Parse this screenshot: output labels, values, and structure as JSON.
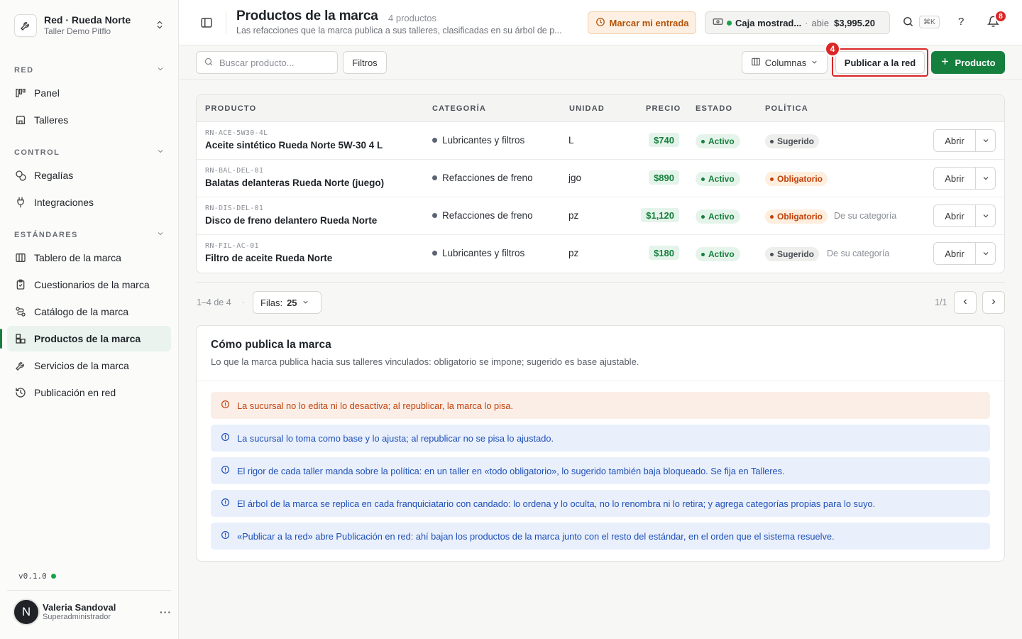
{
  "sidebar": {
    "org": {
      "name": "Red · Rueda Norte",
      "sub": "Taller Demo Pitflo"
    },
    "sections": [
      {
        "label": "RED"
      },
      {
        "label": "CONTROL"
      },
      {
        "label": "ESTÁNDARES"
      }
    ],
    "items": [
      {
        "label": "Panel",
        "icon": "kanban-icon"
      },
      {
        "label": "Talleres",
        "icon": "store-icon"
      },
      {
        "label": "Regalías",
        "icon": "coins-icon"
      },
      {
        "label": "Integraciones",
        "icon": "plug-icon"
      },
      {
        "label": "Tablero de la marca",
        "icon": "columns-icon"
      },
      {
        "label": "Cuestionarios de la marca",
        "icon": "clipboard-icon"
      },
      {
        "label": "Catálogo de la marca",
        "icon": "route-icon"
      },
      {
        "label": "Productos de la marca",
        "icon": "boxes-icon",
        "active": true
      },
      {
        "label": "Servicios de la marca",
        "icon": "wrench-icon"
      },
      {
        "label": "Publicación en red",
        "icon": "history-icon"
      }
    ],
    "version": "v0.1.0",
    "user": {
      "initial": "N",
      "name": "Valeria Sandoval",
      "role": "Superadministrador"
    }
  },
  "header": {
    "title": "Productos de la marca",
    "count": "4 productos",
    "description": "Las refacciones que la marca publica a sus talleres, clasificadas en su árbol de p...",
    "entrada_label": "Marcar mi entrada",
    "caja": {
      "name": "Caja mostrad...",
      "status": "abie",
      "amount": "$3,995.20"
    },
    "kbd": "⌘K",
    "help": "?",
    "notifications": "8"
  },
  "toolbar": {
    "search_placeholder": "Buscar producto...",
    "filters_label": "Filtros",
    "columns_label": "Columnas",
    "publish_label": "Publicar a la red",
    "step_badge": "4",
    "add_label": "Producto"
  },
  "table": {
    "headers": [
      "PRODUCTO",
      "CATEGORÍA",
      "UNIDAD",
      "PRECIO",
      "ESTADO",
      "POLÍTICA"
    ],
    "open_label": "Abrir",
    "rows": [
      {
        "sku": "RN-ACE-5W30-4L",
        "name": "Aceite sintético Rueda Norte 5W-30 4 L",
        "category": "Lubricantes y filtros",
        "unit": "L",
        "price": "$740",
        "status": "Activo",
        "policy": "Sugerido",
        "policy_kind": "sug",
        "note": ""
      },
      {
        "sku": "RN-BAL-DEL-01",
        "name": "Balatas delanteras Rueda Norte (juego)",
        "category": "Refacciones de freno",
        "unit": "jgo",
        "price": "$890",
        "status": "Activo",
        "policy": "Obligatorio",
        "policy_kind": "obl",
        "note": ""
      },
      {
        "sku": "RN-DIS-DEL-01",
        "name": "Disco de freno delantero Rueda Norte",
        "category": "Refacciones de freno",
        "unit": "pz",
        "price": "$1,120",
        "status": "Activo",
        "policy": "Obligatorio",
        "policy_kind": "obl",
        "note": "De su categoría"
      },
      {
        "sku": "RN-FIL-AC-01",
        "name": "Filtro de aceite Rueda Norte",
        "category": "Lubricantes y filtros",
        "unit": "pz",
        "price": "$180",
        "status": "Activo",
        "policy": "Sugerido",
        "policy_kind": "sug",
        "note": "De su categoría"
      }
    ]
  },
  "pager": {
    "range": "1–4 de 4",
    "separator": "·",
    "rows_label": "Filas:",
    "rows_value": "25",
    "page": "1/1"
  },
  "info": {
    "title": "Cómo publica la marca",
    "subtitle": "Lo que la marca publica hacia sus talleres vinculados: obligatorio se impone; sugerido es base ajustable.",
    "notices": [
      {
        "kind": "warn",
        "text": "La sucursal no lo edita ni lo desactiva; al republicar, la marca lo pisa."
      },
      {
        "kind": "info",
        "text": "La sucursal lo toma como base y lo ajusta; al republicar no se pisa lo ajustado."
      },
      {
        "kind": "info",
        "text": "El rigor de cada taller manda sobre la política: en un taller en «todo obligatorio», lo sugerido también baja bloqueado. Se fija en Talleres."
      },
      {
        "kind": "info",
        "text": "El árbol de la marca se replica en cada franquiciatario con candado: lo ordena y lo oculta, no lo renombra ni lo retira; y agrega categorías propias para lo suyo."
      },
      {
        "kind": "info",
        "text": "«Publicar a la red» abre Publicación en red: ahí bajan los productos de la marca junto con el resto del estándar, en el orden que el sistema resuelve."
      }
    ]
  }
}
